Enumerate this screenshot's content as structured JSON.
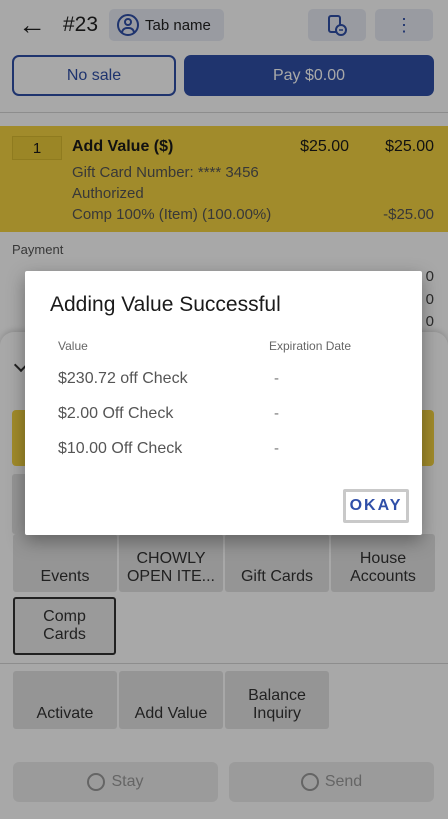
{
  "header": {
    "order_number": "#23",
    "tab_label": "Tab name",
    "no_sale_label": "No sale",
    "pay_label": "Pay $0.00"
  },
  "item": {
    "qty": "1",
    "name": "Add Value ($)",
    "price": "$25.00",
    "total": "$25.00",
    "card_line": "Gift Card Number: **** 3456",
    "status_line": "Authorized",
    "comp_line": "Comp 100% (Item) (100.00%)",
    "comp_amount": "-$25.00"
  },
  "payment": {
    "label": "Payment",
    "values": [
      "0",
      "0",
      "0"
    ]
  },
  "tiles": {
    "events": "Events",
    "chowly": "CHOWLY\nOPEN ITE...",
    "gift_cards": "Gift Cards",
    "house_accounts": "House\nAccounts",
    "comp_cards": "Comp\nCards",
    "activate": "Activate",
    "add_value": "Add Value",
    "balance_inquiry": "Balance\nInquiry"
  },
  "footer": {
    "stay_label": "Stay",
    "send_label": "Send"
  },
  "dialog": {
    "title": "Adding Value Successful",
    "col_value": "Value",
    "col_expiration": "Expiration Date",
    "rows": [
      {
        "value": "$230.72 off Check",
        "expiration": "-"
      },
      {
        "value": "$2.00 Off Check",
        "expiration": "-"
      },
      {
        "value": "$10.00 Off Check",
        "expiration": "-"
      }
    ],
    "okay_label": "OKAY"
  },
  "colors": {
    "primary": "#2f4fa8",
    "item_highlight": "#f5d442",
    "scrim": "rgba(0,0,0,0.34)"
  }
}
